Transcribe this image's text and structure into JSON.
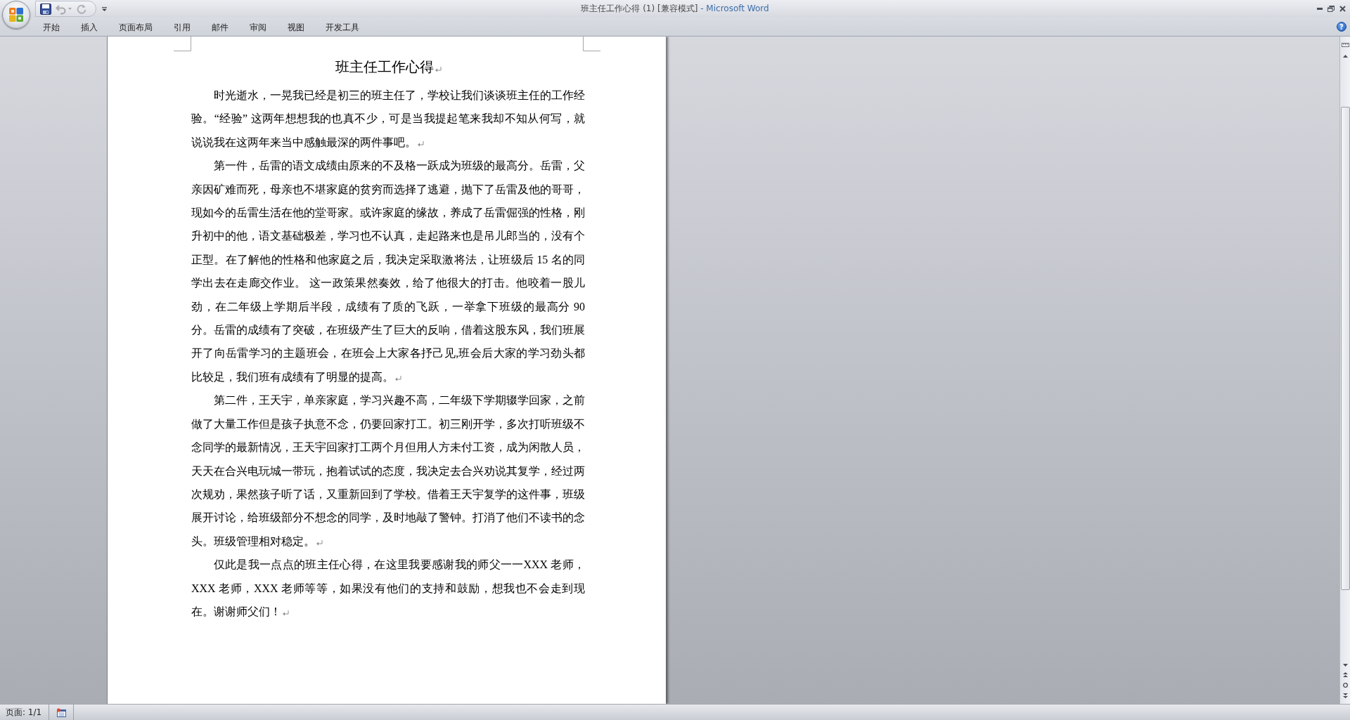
{
  "window": {
    "title": "班主任工作心得 (1) [兼容模式]",
    "app_name": "- Microsoft Word"
  },
  "quick_access": [
    {
      "kind": "save",
      "disabled": false
    },
    {
      "kind": "undo",
      "disabled": true
    },
    {
      "kind": "redo",
      "disabled": true
    }
  ],
  "ribbon_tabs": [
    {
      "label": "开始",
      "selected": false
    },
    {
      "label": "插入",
      "selected": false
    },
    {
      "label": "页面布局",
      "selected": false
    },
    {
      "label": "引用",
      "selected": false
    },
    {
      "label": "邮件",
      "selected": false
    },
    {
      "label": "审阅",
      "selected": false
    },
    {
      "label": "视图",
      "selected": false
    },
    {
      "label": "开发工具",
      "selected": false
    }
  ],
  "help": "?",
  "document": {
    "show_formatting_marks": true,
    "paragraphs": [
      {
        "kind": "title",
        "text": "班主任工作心得"
      },
      {
        "kind": "body",
        "text": "时光逝水，一晃我已经是初三的班主任了，学校让我们谈谈班主任的工作经验。“经验” 这两年想想我的也真不少，可是当我提起笔来我却不知从何写，就说说我在这两年来当中感触最深的两件事吧。"
      },
      {
        "kind": "body",
        "text": "第一件，岳雷的语文成绩由原来的不及格一跃成为班级的最高分。岳雷，父亲因矿难而死，母亲也不堪家庭的贫穷而选择了逃避，抛下了岳雷及他的哥哥，现如今的岳雷生活在他的堂哥家。或许家庭的缘故，养成了岳雷倔强的性格，刚升初中的他，语文基础极差，学习也不认真，走起路来也是吊儿郎当的，没有个正型。在了解他的性格和他家庭之后，我决定采取激将法，让班级后 15 名的同学出去在走廊交作业。 这一政策果然奏效，给了他很大的打击。他咬着一股儿劲，在二年级上学期后半段，成绩有了质的飞跃，一举拿下班级的最高分 90 分。岳雷的成绩有了突破，在班级产生了巨大的反响，借着这股东风，我们班展开了向岳雷学习的主题班会，在班会上大家各抒己见,班会后大家的学习劲头都比较足，我们班有成绩有了明显的提高。"
      },
      {
        "kind": "body",
        "text": "第二件，王天宇，单亲家庭，学习兴趣不高，二年级下学期辍学回家，之前做了大量工作但是孩子执意不念，仍要回家打工。初三刚开学，多次打听班级不念同学的最新情况，王天宇回家打工两个月但用人方未付工资，成为闲散人员，天天在合兴电玩城一带玩，抱着试试的态度，我决定去合兴劝说其复学，经过两次规劝，果然孩子听了话，又重新回到了学校。借着王天宇复学的这件事，班级展开讨论，给班级部分不想念的同学，及时地敲了警钟。打消了他们不读书的念头。班级管理相对稳定。"
      },
      {
        "kind": "body",
        "text": "仅此是我一点点的班主任心得，在这里我要感谢我的师父一一XXX 老师，XXX 老师，XXX 老师等等，如果没有他们的支持和鼓励，想我也不会走到现在。谢谢师父们！"
      }
    ]
  },
  "status_bar": {
    "page": "页面: 1/1"
  }
}
